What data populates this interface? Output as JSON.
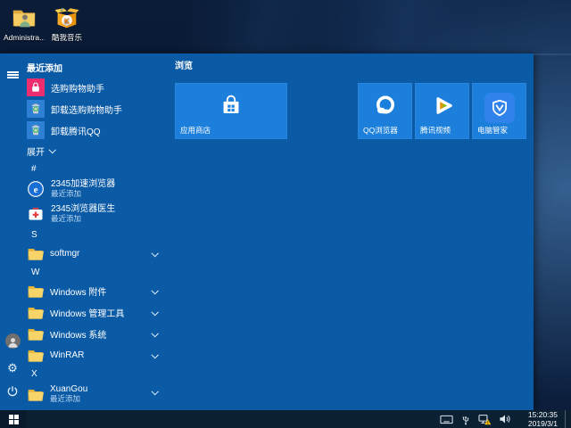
{
  "desktop": {
    "icons": [
      {
        "name": "user-folder",
        "label": "Administra..."
      },
      {
        "name": "kuwo-music",
        "label": "酷我音乐"
      }
    ]
  },
  "start": {
    "recent_header": "最近添加",
    "recent": [
      {
        "label": "选购购物助手",
        "icon": "shopping-bag-icon"
      },
      {
        "label": "卸载选购购物助手",
        "icon": "uninstall-trash-icon"
      },
      {
        "label": "卸载腾讯QQ",
        "icon": "uninstall-trash-icon"
      }
    ],
    "expand_label": "展开",
    "recent_badge": "最近添加",
    "groups": [
      {
        "letter": "#",
        "items": [
          {
            "label": "2345加速浏览器",
            "sub": "最近添加",
            "icon": "browser-e-icon"
          },
          {
            "label": "2345浏览器医生",
            "sub": "最近添加",
            "icon": "first-aid-kit-icon"
          }
        ]
      },
      {
        "letter": "S",
        "items": [
          {
            "label": "softmgr",
            "icon": "folder-icon"
          }
        ]
      },
      {
        "letter": "W",
        "items": [
          {
            "label": "Windows 附件",
            "icon": "folder-icon"
          },
          {
            "label": "Windows 管理工具",
            "icon": "folder-icon"
          },
          {
            "label": "Windows 系统",
            "icon": "folder-icon"
          },
          {
            "label": "WinRAR",
            "icon": "folder-icon"
          }
        ]
      },
      {
        "letter": "X",
        "items": [
          {
            "label": "XuanGou",
            "sub": "最近添加",
            "icon": "folder-icon"
          }
        ]
      }
    ],
    "tiles": {
      "group_header": "浏览",
      "items": [
        {
          "label": "应用商店",
          "size": "wide",
          "icon": "store-bag-icon"
        },
        {
          "label": "QQ浏览器",
          "size": "medium",
          "icon": "qq-browser-icon"
        },
        {
          "label": "腾讯视频",
          "size": "medium",
          "icon": "tencent-video-icon"
        },
        {
          "label": "电脑管家",
          "size": "medium",
          "icon": "pc-manager-shield-icon"
        }
      ]
    },
    "rail": [
      "menu",
      "user",
      "settings",
      "power"
    ]
  },
  "taskbar": {
    "clock": {
      "time": "15:20:35",
      "date": "2019/3/1"
    },
    "tray": [
      "keyboard-icon",
      "usb-icon",
      "network-warning-icon",
      "volume-icon"
    ]
  },
  "colors": {
    "menu_bg": "#0a5aa5",
    "tile_blue": "#1b7fdb",
    "list_icon_square": "#2e80d4",
    "shopping_pink": "#ed2d6e",
    "taskbar_bg": "#0c2033",
    "warning_yellow": "#f6c20a"
  }
}
